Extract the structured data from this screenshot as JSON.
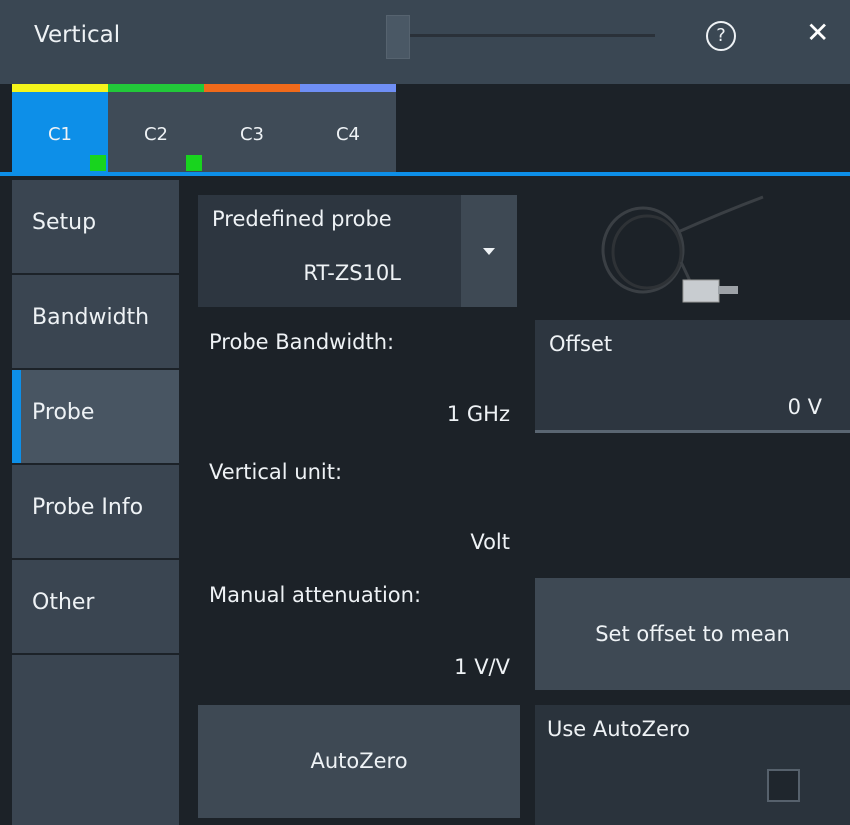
{
  "window": {
    "title": "Vertical"
  },
  "tabs": [
    {
      "label": "C1",
      "color": "#f5f51a",
      "active": true,
      "indicator": true
    },
    {
      "label": "C2",
      "color": "#22c93a",
      "active": false,
      "indicator": true
    },
    {
      "label": "C3",
      "color": "#f06a1a",
      "active": false,
      "indicator": false
    },
    {
      "label": "C4",
      "color": "#6f8ff5",
      "active": false,
      "indicator": false
    }
  ],
  "sidebar": {
    "items": [
      {
        "label": "Setup"
      },
      {
        "label": "Bandwidth"
      },
      {
        "label": "Probe",
        "active": true
      },
      {
        "label": "Probe Info"
      },
      {
        "label": "Other"
      }
    ]
  },
  "probe": {
    "predefined_label": "Predefined probe",
    "predefined_value": "RT-ZS10L",
    "bandwidth_label": "Probe Bandwidth:",
    "bandwidth_value": "1 GHz",
    "offset_label": "Offset",
    "offset_value": "0 V",
    "vertical_unit_label": "Vertical unit:",
    "vertical_unit_value": "Volt",
    "manual_attenuation_label": "Manual attenuation:",
    "manual_attenuation_value": "1 V/V",
    "set_offset_button": "Set offset to mean",
    "autozero_button": "AutoZero",
    "use_autozero_label": "Use AutoZero",
    "use_autozero_checked": false
  },
  "icons": [
    "help-icon",
    "close-icon",
    "dropdown-arrow-icon",
    "probe-image"
  ],
  "colors": {
    "accent": "#0d8fe8",
    "indicator": "#18d41e"
  }
}
